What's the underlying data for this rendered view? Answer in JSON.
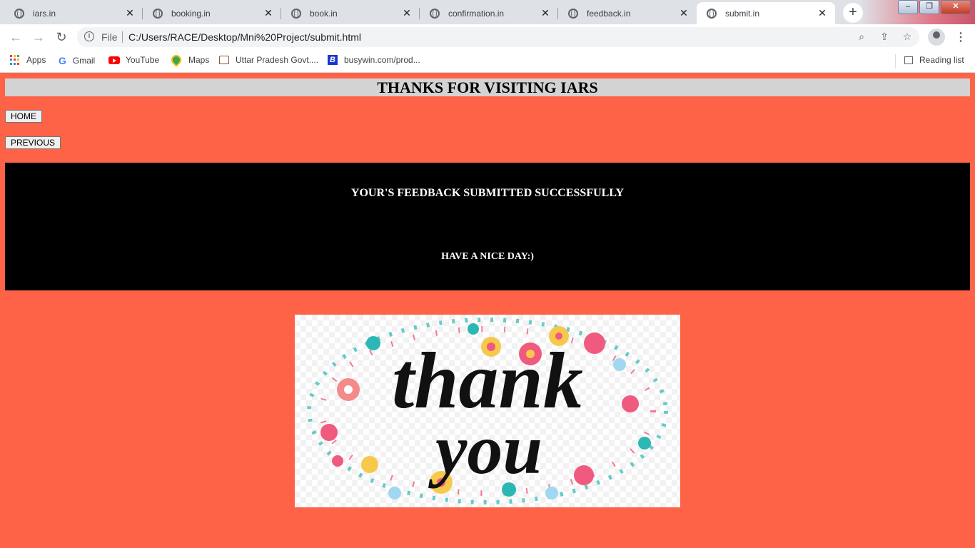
{
  "browser": {
    "tabs": [
      {
        "label": "iars.in"
      },
      {
        "label": "booking.in"
      },
      {
        "label": "book.in"
      },
      {
        "label": "confirmation.in"
      },
      {
        "label": "feedback.in"
      },
      {
        "label": "submit.in",
        "active": true
      }
    ],
    "address": {
      "scheme_label": "File",
      "url": "C:/Users/RACE/Desktop/Mni%20Project/submit.html"
    },
    "bookmarks": [
      {
        "label": "Apps",
        "icon": "apps-grid-icon"
      },
      {
        "label": "Gmail",
        "icon": "google-icon"
      },
      {
        "label": "YouTube",
        "icon": "youtube-icon"
      },
      {
        "label": "Maps",
        "icon": "maps-pin-icon"
      },
      {
        "label": "Uttar Pradesh Govt....",
        "icon": "government-icon"
      },
      {
        "label": "busywin.com/prod...",
        "icon": "busy-icon"
      }
    ],
    "reading_list_label": "Reading list"
  },
  "page": {
    "heading": "THANKS FOR VISITING IARS",
    "home_button": "HOME",
    "previous_button": "PREVIOUS",
    "message_primary": "YOUR'S FEEDBACK SUBMITTED SUCCESSFULLY",
    "message_secondary": "HAVE A NICE DAY:)",
    "image_text": "thank you",
    "background_color": "#ff6347",
    "heading_bar_color": "#d3d3d3",
    "message_box_color": "#000000"
  }
}
